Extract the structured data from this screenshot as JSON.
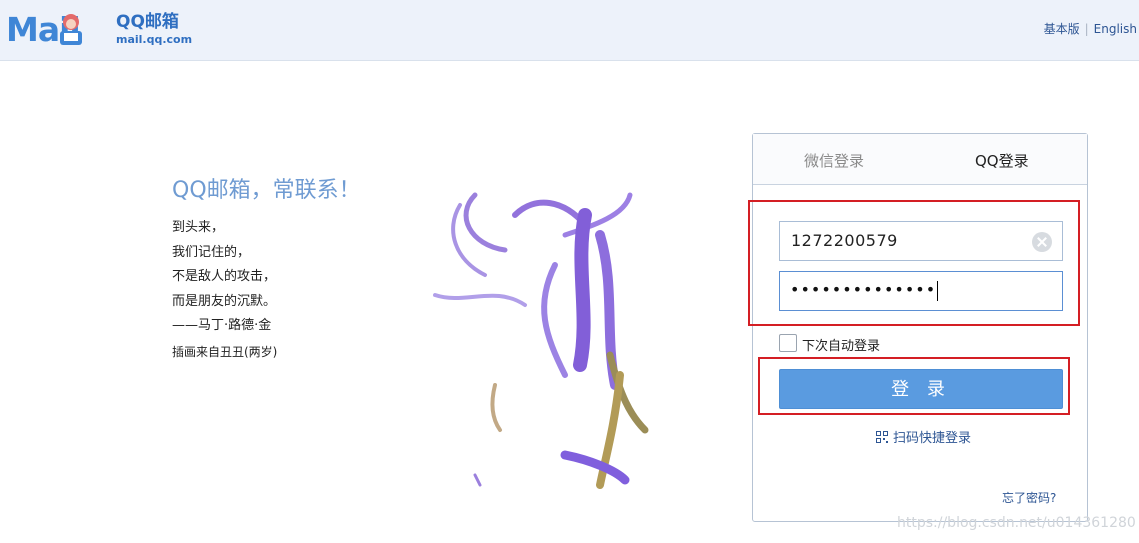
{
  "header": {
    "logo_text": "Mail",
    "logo_cn": "QQ邮箱",
    "logo_url": "mail.qq.com",
    "link_basic": "基本版",
    "link_separator": "|",
    "link_english": "English"
  },
  "intro": {
    "slogan": "QQ邮箱，常联系！",
    "quote_lines": [
      "到头来，",
      "我们记住的，",
      "不是敌人的攻击，",
      "而是朋友的沉默。",
      "——马丁·路德·金"
    ],
    "credit": "插画来自丑丑(两岁)"
  },
  "login": {
    "tab_wechat": "微信登录",
    "tab_qq": "QQ登录",
    "username_value": "1272200579",
    "password_masked": "••••••••••••••",
    "remember_label": "下次自动登录",
    "remember_checked": false,
    "login_button": "登 录",
    "scan_login": "扫码快捷登录",
    "forgot_password": "忘了密码?"
  },
  "watermark": "https://blog.csdn.net/u014361280",
  "colors": {
    "accent": "#5a9be0",
    "highlight_box": "#d41e24",
    "header_bg": "#edf2fa",
    "link": "#2d5593"
  }
}
